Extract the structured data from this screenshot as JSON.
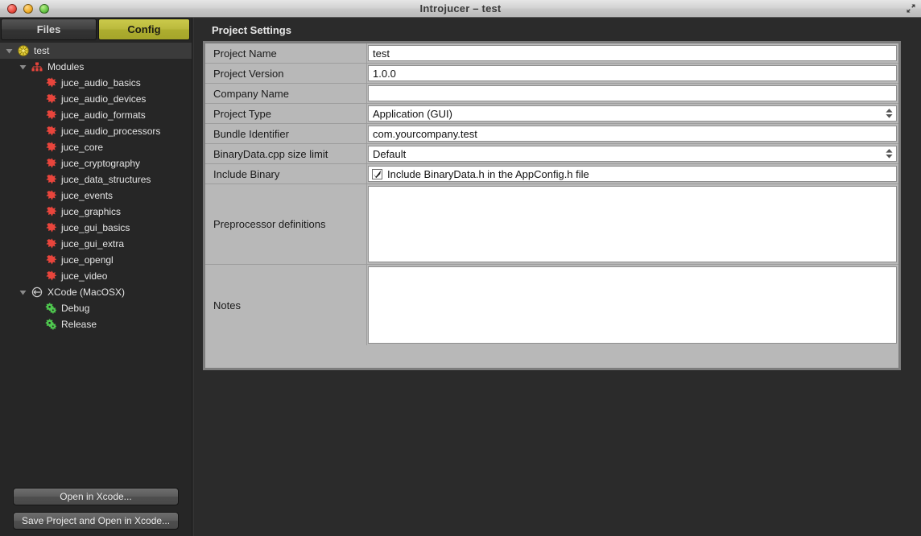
{
  "window": {
    "title": "Introjucer – test",
    "controls": {
      "close": "close-button",
      "minimize": "minimize-button",
      "zoom": "zoom-button"
    },
    "fullscreen_label": "fullscreen-toggle"
  },
  "sidebar": {
    "tabs": [
      {
        "label": "Files",
        "active": false
      },
      {
        "label": "Config",
        "active": true
      }
    ],
    "tree": [
      {
        "label": "test",
        "depth": 0,
        "icon": "project-icon",
        "disclosure": "open",
        "selected": true
      },
      {
        "label": "Modules",
        "depth": 1,
        "icon": "modules-icon",
        "disclosure": "open",
        "selected": false
      },
      {
        "label": "juce_audio_basics",
        "depth": 2,
        "icon": "module-icon",
        "disclosure": "none",
        "selected": false
      },
      {
        "label": "juce_audio_devices",
        "depth": 2,
        "icon": "module-icon",
        "disclosure": "none",
        "selected": false
      },
      {
        "label": "juce_audio_formats",
        "depth": 2,
        "icon": "module-icon",
        "disclosure": "none",
        "selected": false
      },
      {
        "label": "juce_audio_processors",
        "depth": 2,
        "icon": "module-icon",
        "disclosure": "none",
        "selected": false
      },
      {
        "label": "juce_core",
        "depth": 2,
        "icon": "module-icon",
        "disclosure": "none",
        "selected": false
      },
      {
        "label": "juce_cryptography",
        "depth": 2,
        "icon": "module-icon",
        "disclosure": "none",
        "selected": false
      },
      {
        "label": "juce_data_structures",
        "depth": 2,
        "icon": "module-icon",
        "disclosure": "none",
        "selected": false
      },
      {
        "label": "juce_events",
        "depth": 2,
        "icon": "module-icon",
        "disclosure": "none",
        "selected": false
      },
      {
        "label": "juce_graphics",
        "depth": 2,
        "icon": "module-icon",
        "disclosure": "none",
        "selected": false
      },
      {
        "label": "juce_gui_basics",
        "depth": 2,
        "icon": "module-icon",
        "disclosure": "none",
        "selected": false
      },
      {
        "label": "juce_gui_extra",
        "depth": 2,
        "icon": "module-icon",
        "disclosure": "none",
        "selected": false
      },
      {
        "label": "juce_opengl",
        "depth": 2,
        "icon": "module-icon",
        "disclosure": "none",
        "selected": false
      },
      {
        "label": "juce_video",
        "depth": 2,
        "icon": "module-icon",
        "disclosure": "none",
        "selected": false
      },
      {
        "label": "XCode (MacOSX)",
        "depth": 1,
        "icon": "exporter-icon",
        "disclosure": "open",
        "selected": false
      },
      {
        "label": "Debug",
        "depth": 2,
        "icon": "config-icon",
        "disclosure": "none",
        "selected": false
      },
      {
        "label": "Release",
        "depth": 2,
        "icon": "config-icon",
        "disclosure": "none",
        "selected": false
      }
    ],
    "buttons": [
      {
        "label": "Open in Xcode..."
      },
      {
        "label": "Save Project and Open in Xcode..."
      }
    ]
  },
  "main": {
    "panel_title": "Project Settings",
    "rows": [
      {
        "label": "Project Name",
        "value": "test",
        "kind": "text"
      },
      {
        "label": "Project Version",
        "value": "1.0.0",
        "kind": "text"
      },
      {
        "label": "Company Name",
        "value": "",
        "kind": "text"
      },
      {
        "label": "Project Type",
        "value": "Application (GUI)",
        "kind": "combo"
      },
      {
        "label": "Bundle Identifier",
        "value": "com.yourcompany.test",
        "kind": "text"
      },
      {
        "label": "BinaryData.cpp size limit",
        "value": "Default",
        "kind": "combo"
      },
      {
        "label": "Include Binary",
        "value": "Include BinaryData.h in the AppConfig.h file",
        "kind": "checkbox",
        "checked": true
      },
      {
        "label": "Preprocessor definitions",
        "value": "",
        "kind": "multiline"
      },
      {
        "label": "Notes",
        "value": "",
        "kind": "multiline"
      }
    ]
  },
  "colors": {
    "accent_tab": "#b8b83a",
    "window_bg": "#262626",
    "panel_label_bg": "#b8b8b8",
    "module_icon": "#e8453c",
    "config_icon": "#4fc94f",
    "project_icon": "#e8d33a"
  }
}
